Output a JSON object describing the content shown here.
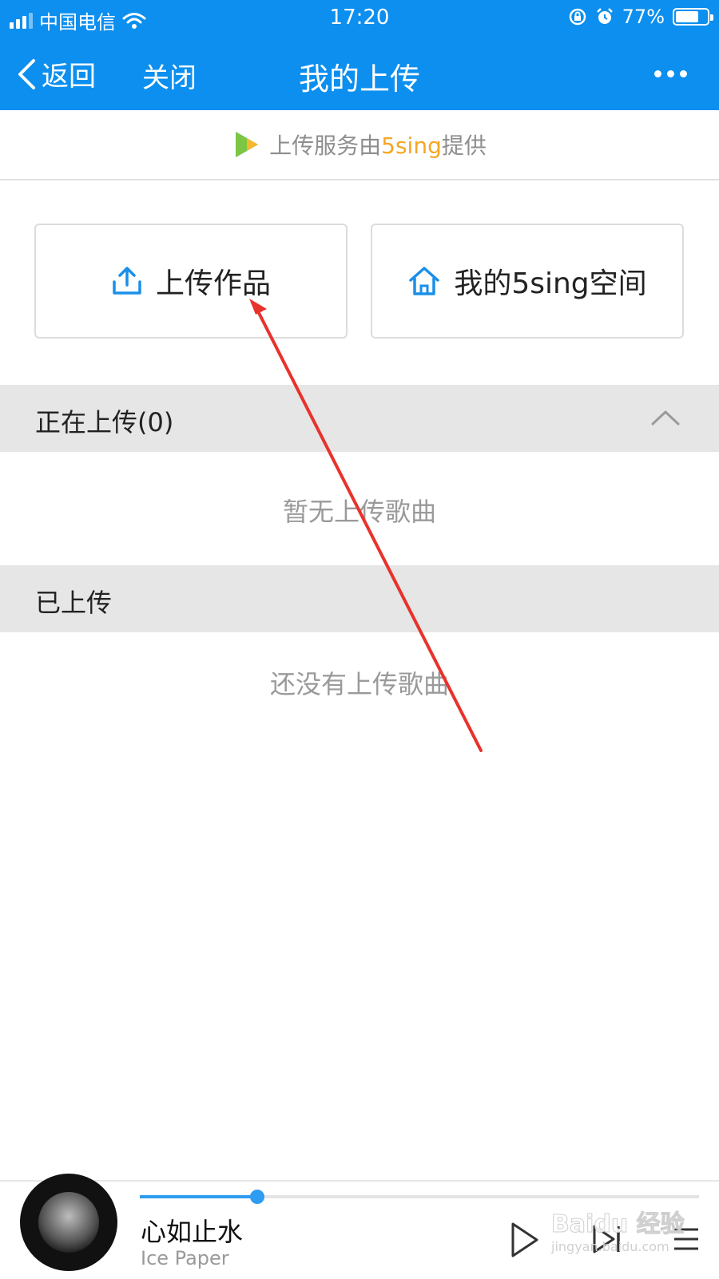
{
  "status_bar": {
    "carrier": "中国电信",
    "time": "17:20",
    "battery_text": "77%",
    "battery_level": 0.77
  },
  "nav": {
    "back_label": "返回",
    "close_label": "关闭",
    "title": "我的上传"
  },
  "provider": {
    "prefix": "上传服务由",
    "brand": "5sing",
    "suffix": "提供"
  },
  "actions": {
    "upload_label": "上传作品",
    "space_label": "我的5sing空间"
  },
  "uploading": {
    "header": "正在上传(0)",
    "empty_text": "暂无上传歌曲"
  },
  "uploaded": {
    "header": "已上传",
    "empty_text": "还没有上传歌曲"
  },
  "player": {
    "song_title": "心如止水",
    "artist": "Ice Paper",
    "progress": 0.21
  },
  "watermark": {
    "text": "Baidu 经验",
    "sub": "jingyan.baidu.com"
  },
  "colors": {
    "brand_blue": "#0c8fef",
    "accent_orange": "#f5a623",
    "progress_blue": "#2e9cf0",
    "annotation_red": "#e8322c"
  },
  "icons": [
    "back-chevron-icon",
    "more-dots-icon",
    "upload-icon",
    "home-icon",
    "chevron-up-icon",
    "play-icon",
    "next-icon",
    "playlist-icon"
  ]
}
